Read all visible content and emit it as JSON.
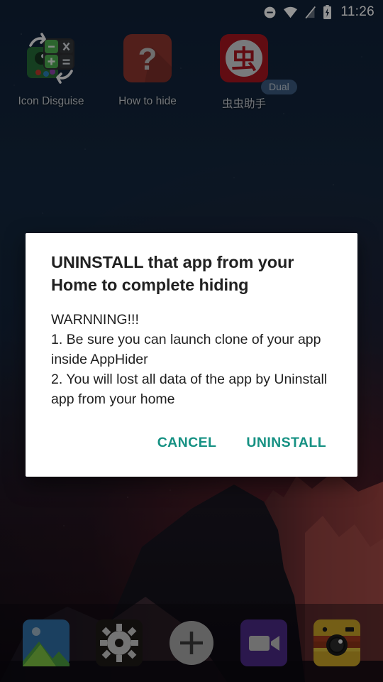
{
  "status_bar": {
    "time": "11:26",
    "icons": [
      {
        "name": "do-not-disturb-icon"
      },
      {
        "name": "wifi-icon"
      },
      {
        "name": "signal-off-icon"
      },
      {
        "name": "battery-charging-icon"
      }
    ]
  },
  "home_screen": {
    "apps": [
      {
        "label": "Icon Disguise",
        "icon": "icon-disguise-icon",
        "badge": null
      },
      {
        "label": "How to hide",
        "icon": "question-mark-icon",
        "badge": null
      },
      {
        "label": "虫虫助手",
        "icon": "chongchong-helper-icon",
        "badge": "Dual"
      }
    ]
  },
  "dock": {
    "items": [
      {
        "name": "gallery-icon"
      },
      {
        "name": "settings-gear-icon"
      },
      {
        "name": "add-plus-icon"
      },
      {
        "name": "video-camera-icon"
      },
      {
        "name": "camera-icon"
      }
    ]
  },
  "dialog": {
    "title": "UNINSTALL that app from your Home to complete hiding",
    "message": "WARNNING!!!\n 1. Be sure you can launch clone of your app inside AppHider\n 2. You will lost all data of the app by Uninstall app from your home",
    "cancel_label": "CANCEL",
    "confirm_label": "UNINSTALL"
  },
  "colors": {
    "accent": "#169183",
    "dialog_background": "#ffffff",
    "title_text": "#212121",
    "badge_background": "#3b5a80",
    "wallpaper_top": "#102138"
  }
}
